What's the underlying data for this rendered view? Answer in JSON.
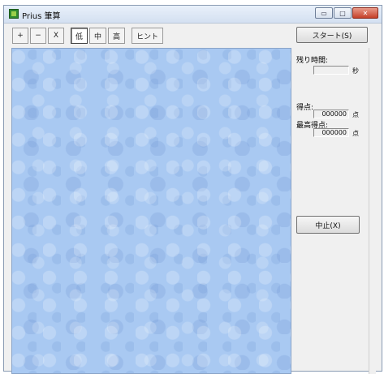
{
  "window": {
    "title": "Prius 筆算",
    "controls": {
      "minimize": "▭",
      "maximize": "□",
      "close": "✕"
    }
  },
  "toolbar": {
    "plus": "+",
    "minus": "−",
    "times": "X",
    "low": "低",
    "mid": "中",
    "high": "高",
    "hint": "ヒント"
  },
  "panel": {
    "start_label": "スタート(S)",
    "time_label": "残り時間:",
    "time_value": "",
    "time_unit": "秒",
    "score_label": "得点:",
    "score_value": "000000",
    "score_unit": "点",
    "best_label": "最高得点:",
    "best_value": "000000",
    "best_unit": "点",
    "stop_label": "中止(X)"
  }
}
